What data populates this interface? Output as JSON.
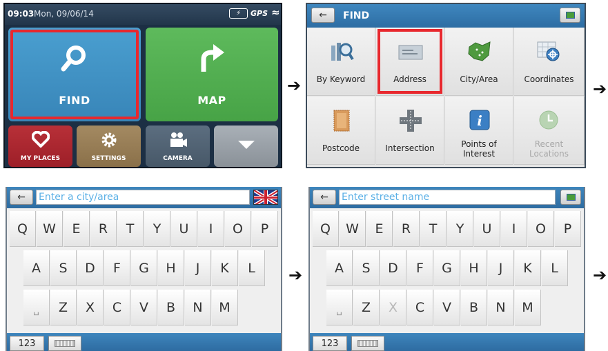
{
  "arrows": [
    "➔",
    "➔",
    "➔",
    "➔"
  ],
  "main_menu": {
    "time": "09:03",
    "date": "Mon, 09/06/14",
    "battery_glyph": "⚡",
    "gps_label": "GPS",
    "signal_glyph": "≈",
    "tiles": {
      "find": {
        "label": "FIND",
        "icon": "magnifier-icon"
      },
      "map": {
        "label": "MAP",
        "icon": "turn-arrow-icon"
      },
      "my_places": {
        "label": "MY PLACES",
        "icon": "heart-icon"
      },
      "settings": {
        "label": "SETTINGS",
        "icon": "gear-icon"
      },
      "camera": {
        "label": "CAMERA",
        "icon": "camera-icon"
      },
      "more": {
        "label": "",
        "icon": "chevron-down-icon"
      }
    },
    "highlight_color": "#e8282e"
  },
  "find_menu": {
    "back_glyph": "←",
    "title": "FIND",
    "items": [
      {
        "label": "By Keyword",
        "icon": "keyword-search-icon"
      },
      {
        "label": "Address",
        "icon": "address-card-icon",
        "selected": true
      },
      {
        "label": "City/Area",
        "icon": "map-region-icon"
      },
      {
        "label": "Coordinates",
        "icon": "crosshair-grid-icon"
      },
      {
        "label": "Postcode",
        "icon": "stamp-icon"
      },
      {
        "label": "Intersection",
        "icon": "crossroads-icon"
      },
      {
        "label": "Points of Interest",
        "icon": "info-icon"
      },
      {
        "label": "Recent Locations",
        "icon": "clock-icon",
        "disabled": true
      }
    ]
  },
  "keyboard_city": {
    "back_glyph": "←",
    "placeholder": "Enter a city/area",
    "row1": [
      "Q",
      "W",
      "E",
      "R",
      "T",
      "Y",
      "U",
      "I",
      "O",
      "P"
    ],
    "row2": [
      "A",
      "S",
      "D",
      "F",
      "G",
      "H",
      "J",
      "K",
      "L"
    ],
    "row3": [
      "Z",
      "X",
      "C",
      "V",
      "B",
      "N",
      "M"
    ],
    "space_glyph": "␣",
    "numeric_label": "123"
  },
  "keyboard_street": {
    "back_glyph": "←",
    "placeholder": "Enter street name",
    "row1": [
      "Q",
      "W",
      "E",
      "R",
      "T",
      "Y",
      "U",
      "I",
      "O",
      "P"
    ],
    "row2": [
      "A",
      "S",
      "D",
      "F",
      "G",
      "H",
      "J",
      "K",
      "L"
    ],
    "row3": [
      "Z",
      "X",
      "C",
      "V",
      "B",
      "N",
      "M"
    ],
    "disabled_keys": [
      "X"
    ],
    "space_glyph": "␣",
    "numeric_label": "123"
  }
}
